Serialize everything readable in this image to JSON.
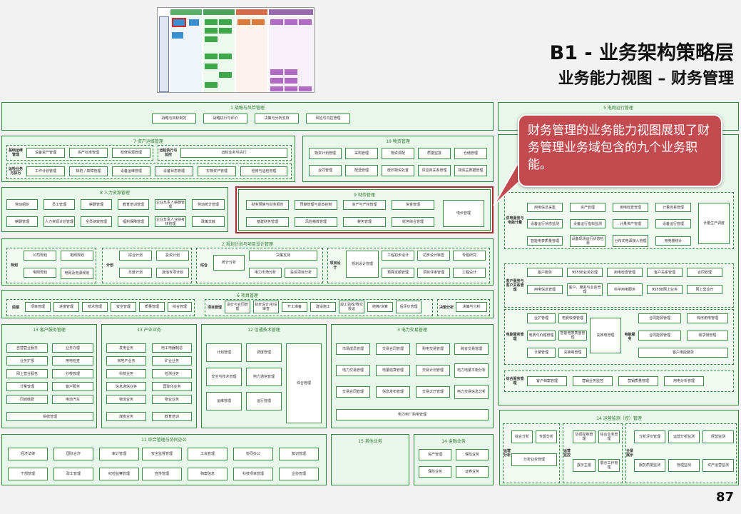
{
  "title": "B1 - 业务架构策略层",
  "subtitle": "业务能力视图 – 财务管理",
  "page_number": "87",
  "callout": "财务管理的业务能力视图展现了财务管理业务域包含的九个业务职能。",
  "colors": {
    "panel_border": "#2e8b3e",
    "panel_fill": "#e9f6ea",
    "highlight": "#a62e2e",
    "callout": "#c34b4f"
  },
  "panels": [
    {
      "name": "p1",
      "title": "1 战略与风险管理",
      "caps": [
        "战略与目标制定",
        "战略执行与评价",
        "决策与分析支持",
        "风险与内控管理"
      ]
    },
    {
      "name": "p5",
      "title": "5 电网运行管理",
      "caps": []
    },
    {
      "name": "p7",
      "title": "7 资产运维管理",
      "rows": [
        "基础运维管理",
        "运检执行与监控",
        "运检业务与执行"
      ],
      "caps": [
        "设备资产管理",
        "资产标准管理",
        "检修资源管理",
        "运检业务与执行",
        "工作计划管理",
        "缺陷 / 故障管理",
        "设备运维管理",
        "设备状态管理",
        "实物资产管理",
        "检修与运检管理"
      ]
    },
    {
      "name": "p10",
      "title": "10 物资管理",
      "caps": [
        "物资计划管理",
        "采购管理",
        "物资调配",
        "质量监督",
        "仓储管理",
        "合同管理",
        "配送管理",
        "废旧物资处置",
        "供应商关系管理",
        "物资主数据管理"
      ]
    },
    {
      "name": "p8",
      "title": "8 人力资源管理",
      "caps": [
        "劳动组织",
        "员工管理",
        "薪酬管理",
        "教育培训管理",
        "企业负责人薪酬管理",
        "劳动统计管理",
        "薪酬管理",
        "人力资源计划管理",
        "全员绩效管理",
        "福利保障管理",
        "企业负责人业绩考核管理",
        "政策文献"
      ]
    },
    {
      "name": "p9",
      "title": "9 财务管理",
      "caps": [
        "财务预算与财务报告",
        "预算管理与成本控制",
        "资产与产权管理",
        "资金管理",
        "电价管理",
        "基建财务管理",
        "风险稽核管理",
        "税务管理",
        "财务综合管理"
      ]
    },
    {
      "name": "p2",
      "title": "2 规划计划与项目设计管理",
      "rows": [
        "规划",
        "计划",
        "综合",
        "项目设计"
      ],
      "caps": [
        "公司规划",
        "电网规划",
        "电网规划",
        "电网及电源规划",
        "综合计划",
        "投资计划",
        "年度计划",
        "其他专项计划",
        "统计分析",
        "决策支持",
        "电力市场分析",
        "投资项目分析",
        "规划设计管理",
        "工程初步设计",
        "初步设计审查",
        "施工图设计",
        "预算定额管理",
        "项目评审管理",
        "专题研究",
        "工程设计"
      ]
    },
    {
      "name": "p6",
      "title": "6 项目管理",
      "rows": [
        "前期",
        "项目管理",
        "决策分析"
      ],
      "caps": [
        "项目管理",
        "进度管理",
        "技术管理",
        "安全管理",
        "质量管理",
        "综合管理",
        "造价与合同管理",
        "初步设计/初设审查",
        "开工准备",
        "建设施工",
        "竣工验收/移交投运",
        "结算/决算",
        "后评价管理",
        "决策与分析"
      ]
    },
    {
      "name": "p13a",
      "title": "13 客户服务管理",
      "caps": [
        "自营营业服务",
        "业务办理",
        "业务扩报",
        "用电检查",
        "网上营业服务",
        "抄核管理",
        "计量管理",
        "客户服务",
        "同城缴费",
        "电动汽车",
        "电费结算",
        "系统管理"
      ]
    },
    {
      "name": "p13b",
      "title": "13 产业业务",
      "caps": [
        "发电业务",
        "电工电器制造",
        "房地产业务",
        "矿业业务",
        "科技业务",
        "检测业务",
        "信息通信业务",
        "国际化业务",
        "物流业务",
        "物业业务",
        "煤炭业务",
        "教育培训"
      ]
    },
    {
      "name": "p12",
      "title": "12 信通技术管理",
      "caps": [
        "计划管理",
        "调度管理",
        "安全与技术管理",
        "电力通信管理",
        "运维管理",
        "运行管理",
        "综合管理"
      ]
    },
    {
      "name": "p3",
      "title": "3 电力交易管理",
      "caps": [
        "市场成员管理",
        "交易合同管理",
        "购电交易管理",
        "跨省交易管理",
        "电力交易管理",
        "电量结算管理",
        "交易计划管理",
        "电力电量平衡分析",
        "交易合同管理",
        "信息发布管理",
        "交易大厅管理",
        "电力交易信息分析",
        "电力电厂购电管理"
      ]
    },
    {
      "name": "p4",
      "title": "4 营销管理",
      "rows": [
        "供电服务与电能计量",
        "客户服务与客户关系管理",
        "电能服务管理",
        "有序用电",
        "综合服务管理"
      ],
      "caps": [
        "用电信息采集",
        "资产管理",
        "用电检查管理",
        "计量体系管理",
        "设备运行状态监测",
        "设备运行指标监测",
        "计量资产管理",
        "设备运行管理",
        "计量生产调度",
        "智能电表质量管理",
        "设备现场运行状态检测",
        "分布式电源接入管理",
        "用电量统计",
        "客户服务",
        "95598业务处理",
        "用电检查管理",
        "客户关系管理",
        "合同管理",
        "智能客户服务",
        "用电信息管理",
        "客户、服务与业务管理",
        "科学用电服务",
        "95598网上业务",
        "网上营业厅",
        "业扩管理",
        "电费收缴管理",
        "电费与价格管理",
        "计量管理",
        "充换电管理",
        "电能服务",
        "合同能源管理",
        "客户用能服务",
        "有序用电管理",
        "智能小区与家庭用电",
        "智能用电服务",
        "需求侧管理",
        "营销稽查管理",
        "客户档案管理",
        "营销业务监控",
        "营销质量管理",
        "用电分析管理"
      ]
    },
    {
      "name": "p11",
      "title": "11 综合管理与协同办公",
      "caps": [
        "经济法律",
        "国际合作",
        "审计管理",
        "安全监督管理",
        "工会管理",
        "协同办公",
        "知识管理",
        "干部管理",
        "政工管理",
        "纪检监察管理",
        "宣传管理",
        "档案信息",
        "科技项目管理",
        "企协管理"
      ]
    },
    {
      "name": "p15",
      "title": "15 其他业务",
      "caps": []
    },
    {
      "name": "p14",
      "title": "14 金融业务",
      "caps": [
        "资产管理",
        "保险业务",
        "保险业务",
        "证券业务"
      ]
    },
    {
      "name": "p14b",
      "title": "14 运营监测（控）管理",
      "rows": [
        "运营分析",
        "运营监控",
        "全景展示"
      ],
      "caps": [
        "综合分析",
        "专题分析",
        "协调控制管理",
        "综合业务管理",
        "分析评价管理",
        "运营分析监测",
        "经营监测",
        "对标分析管理",
        "分析业务管理",
        "展示主题",
        "展示工作管理",
        "管理监测",
        "服务质量监测",
        "资产运营监测"
      ]
    }
  ]
}
